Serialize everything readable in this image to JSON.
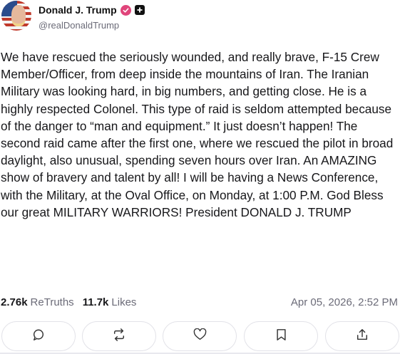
{
  "author": {
    "display_name": "Donald J. Trump",
    "handle": "@realDonaldTrump"
  },
  "post": {
    "text": "We have rescued the seriously wounded, and really brave, F-15 Crew Member/Officer, from deep inside the mountains of Iran. The Iranian Military was looking hard, in big numbers, and getting close. He is a highly respected Colonel. This type of raid is seldom attempted because of the danger to “man and equipment.” It just doesn’t happen! The second raid came after the first one, where we rescued the pilot in broad daylight, also unusual, spending seven hours over Iran. An AMAZING show of bravery and talent by all! I will be having a News Conference, with the Military, at the Oval Office, on Monday, at 1:00 P.M. God Bless our great MILITARY WARRIORS! President DONALD J. TRUMP",
    "retruths_count": "2.76k",
    "retruths_label": "ReTruths",
    "likes_count": "11.7k",
    "likes_label": "Likes",
    "timestamp": "Apr 05, 2026, 2:52 PM"
  },
  "icons": {
    "verified": "verified-badge-icon",
    "plus": "plus-square-icon",
    "reply": "reply-bubble-icon",
    "retruth": "retruth-arrows-icon",
    "like": "heart-icon",
    "bookmark": "bookmark-icon",
    "share": "share-upload-icon"
  },
  "colors": {
    "verified_badge": "#e0457b",
    "muted_text": "#6b6b78",
    "button_border": "#e2e2e8"
  }
}
